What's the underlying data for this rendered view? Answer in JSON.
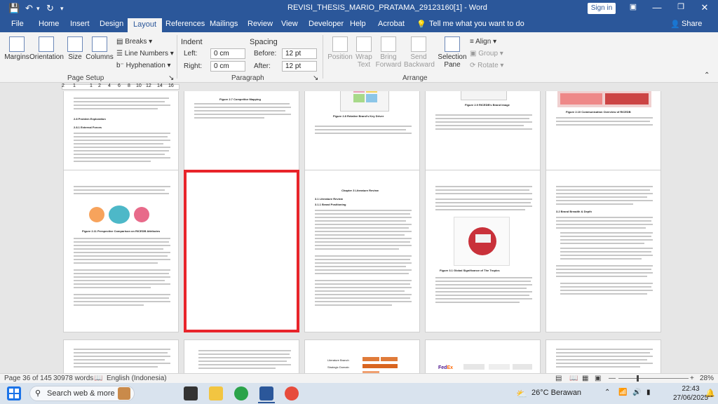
{
  "window": {
    "title": "REVISI_THESIS_MARIO_PRATAMA_29123160[1] - Word",
    "sign_in": "Sign in"
  },
  "quick_access": {
    "save_icon": "save-icon",
    "undo_icon": "undo-icon",
    "redo_icon": "redo-icon",
    "customize_icon": "dropdown-icon"
  },
  "tabs": [
    {
      "label": "File"
    },
    {
      "label": "Home"
    },
    {
      "label": "Insert"
    },
    {
      "label": "Design"
    },
    {
      "label": "Layout"
    },
    {
      "label": "References"
    },
    {
      "label": "Mailings"
    },
    {
      "label": "Review"
    },
    {
      "label": "View"
    },
    {
      "label": "Developer"
    },
    {
      "label": "Help"
    },
    {
      "label": "Acrobat"
    },
    {
      "label": "Tell me what you want to do"
    }
  ],
  "share": "Share",
  "page_setup": {
    "group": "Page Setup",
    "margins": "Margins",
    "orientation": "Orientation",
    "size": "Size",
    "columns": "Columns",
    "breaks": "Breaks",
    "line_numbers": "Line Numbers",
    "hyphenation": "Hyphenation"
  },
  "paragraph": {
    "group": "Paragraph",
    "indent": "Indent",
    "left_label": "Left:",
    "left_value": "0 cm",
    "right_label": "Right:",
    "right_value": "0 cm",
    "spacing": "Spacing",
    "before_label": "Before:",
    "before_value": "12 pt",
    "after_label": "After:",
    "after_value": "12 pt"
  },
  "arrange": {
    "group": "Arrange",
    "position": "Position",
    "wrap_text": "Wrap Text",
    "bring_forward": "Bring Forward",
    "send_backward": "Send Backward",
    "selection_pane": "Selection Pane",
    "align": "Align",
    "group_btn": "Group",
    "rotate": "Rotate"
  },
  "ruler": {
    "ticks": [
      "2",
      "1",
      "1",
      "2",
      "4",
      "6",
      "8",
      "10",
      "12",
      "14",
      "16"
    ]
  },
  "pages": {
    "p1_heading1": "2.8 Problem Exploration",
    "p1_heading2": "2.8.1 External Forces",
    "p2_caption": "Figure 2.7 Competitor Mapping",
    "p3_caption": "Figure 2.8 Relative Brand's Key Driver",
    "p4_caption": "Figure 2.9 RICEDB's Brand Image",
    "p5_caption": "Figure 2.10 Communication Overview of RICEDB",
    "p6_caption": "Figure 2.11 Perspective Comparison on RICEDB Attributes",
    "p8_heading": "Chapter 3 Literature Review",
    "p8_sub": "3.1 Literature Review",
    "p8_sub2": "3.1.1 Brand Positioning",
    "p9_caption": "Figure 3.1 Global Significance of The Tropics",
    "p10_heading": "3.2 Brand Breadth & Depth",
    "p13_label1": "Literature Branch",
    "p13_label2": "Strategic Domain"
  },
  "status": {
    "page": "Page 36 of 145",
    "words": "30978 words",
    "language": "English (Indonesia)",
    "zoom": "28%"
  },
  "taskbar": {
    "search": "Search web & more",
    "weather": "26°C  Berawan",
    "time": "22:43",
    "date": "27/06/2025"
  }
}
